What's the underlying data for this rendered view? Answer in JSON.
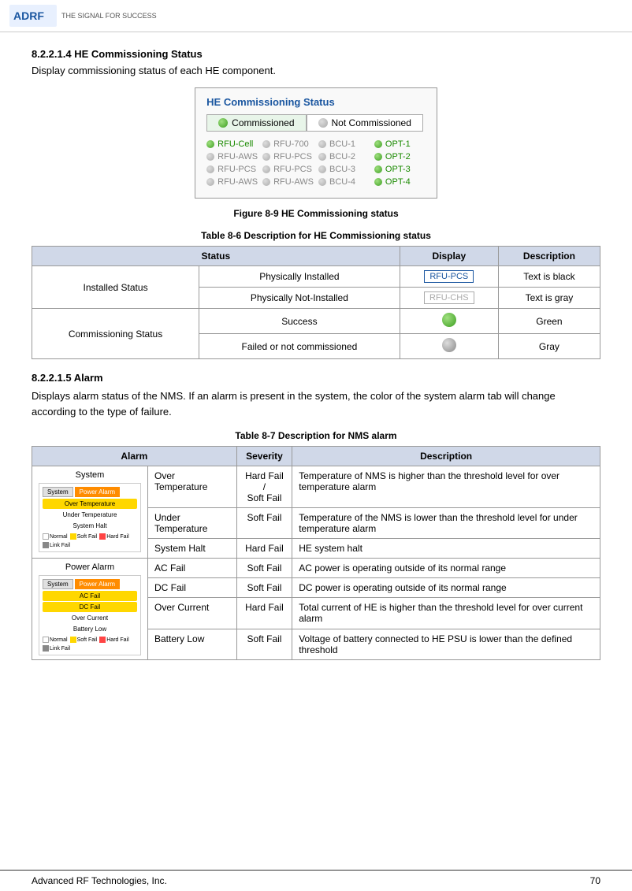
{
  "header": {
    "logo_text": "ADRF",
    "tagline": "THE SIGNAL FOR SUCCESS"
  },
  "section_8221": {
    "heading": "8.2.2.1.4   HE Commissioning Status",
    "body": "Display commissioning status of each HE component.",
    "box_title": "HE Commissioning Status",
    "legend": {
      "commissioned_label": "Commissioned",
      "not_commissioned_label": "Not Commissioned"
    },
    "components": [
      {
        "label": "RFU-Cell",
        "color": "green"
      },
      {
        "label": "RFU-700",
        "color": "gray"
      },
      {
        "label": "BCU-1",
        "color": "gray"
      },
      {
        "label": "OPT-1",
        "color": "green"
      },
      {
        "label": "RFU-AWS",
        "color": "gray"
      },
      {
        "label": "RFU-PCS",
        "color": "gray"
      },
      {
        "label": "BCU-2",
        "color": "gray"
      },
      {
        "label": "OPT-2",
        "color": "green"
      },
      {
        "label": "RFU-PCS",
        "color": "gray"
      },
      {
        "label": "RFU-PCS",
        "color": "gray"
      },
      {
        "label": "BCU-3",
        "color": "gray"
      },
      {
        "label": "OPT-3",
        "color": "green"
      },
      {
        "label": "RFU-AWS",
        "color": "gray"
      },
      {
        "label": "RFU-AWS",
        "color": "gray"
      },
      {
        "label": "BCU-4",
        "color": "gray"
      },
      {
        "label": "OPT-4",
        "color": "green"
      }
    ],
    "figure_caption": "Figure 8-9     HE Commissioning status",
    "table_caption": "Table 8-6     Description for HE Commissioning status",
    "table_headers": [
      "Status",
      "Display",
      "Description"
    ],
    "table_rows": [
      {
        "row_header": "Installed Status",
        "sub_rows": [
          {
            "label": "Physically Installed",
            "display_type": "rfu-pcs",
            "description": "Text is black"
          },
          {
            "label": "Physically Not-Installed",
            "display_type": "rfu-chs",
            "description": "Text is gray"
          }
        ]
      },
      {
        "row_header": "Commissioning  Status",
        "sub_rows": [
          {
            "label": "Success",
            "display_type": "dot-green",
            "description": "Green"
          },
          {
            "label": "Failed or not commissioned",
            "display_type": "dot-gray",
            "description": "Gray"
          }
        ]
      }
    ]
  },
  "section_82215": {
    "heading": "8.2.2.1.5   Alarm",
    "body": "Displays alarm status of the NMS. If an alarm is present in the system, the color of the system alarm tab will change according to the type of failure.",
    "table_caption": "Table 8-7     Description for NMS alarm",
    "table_headers": [
      "Alarm",
      "Severity",
      "Description"
    ],
    "alarm_rows": [
      {
        "alarm_group": "System",
        "sub_rows": [
          {
            "label": "Over Temperature",
            "severity": "Hard Fail / Soft Fail",
            "description": "Temperature of NMS is higher than the threshold level for over temperature alarm"
          },
          {
            "label": "Under Temperature",
            "severity": "Soft Fail",
            "description": "Temperature of the NMS is lower than the threshold level for under temperature alarm"
          },
          {
            "label": "System Halt",
            "severity": "Hard Fail",
            "description": "HE system halt"
          }
        ]
      },
      {
        "alarm_group": "Power Alarm",
        "sub_rows": [
          {
            "label": "AC Fail",
            "severity": "Soft Fail",
            "description": "AC power is operating outside of its normal range"
          },
          {
            "label": "DC Fail",
            "severity": "Soft Fail",
            "description": "DC power is operating outside of its normal range"
          },
          {
            "label": "Over Current",
            "severity": "Hard Fail",
            "description": "Total current of HE is higher than the threshold level for over current alarm"
          },
          {
            "label": "Battery Low",
            "severity": "Soft Fail",
            "description": "Voltage of battery connected to HE PSU is lower than the defined threshold"
          }
        ]
      }
    ]
  },
  "footer": {
    "company": "Advanced RF Technologies, Inc.",
    "page_number": "70"
  }
}
